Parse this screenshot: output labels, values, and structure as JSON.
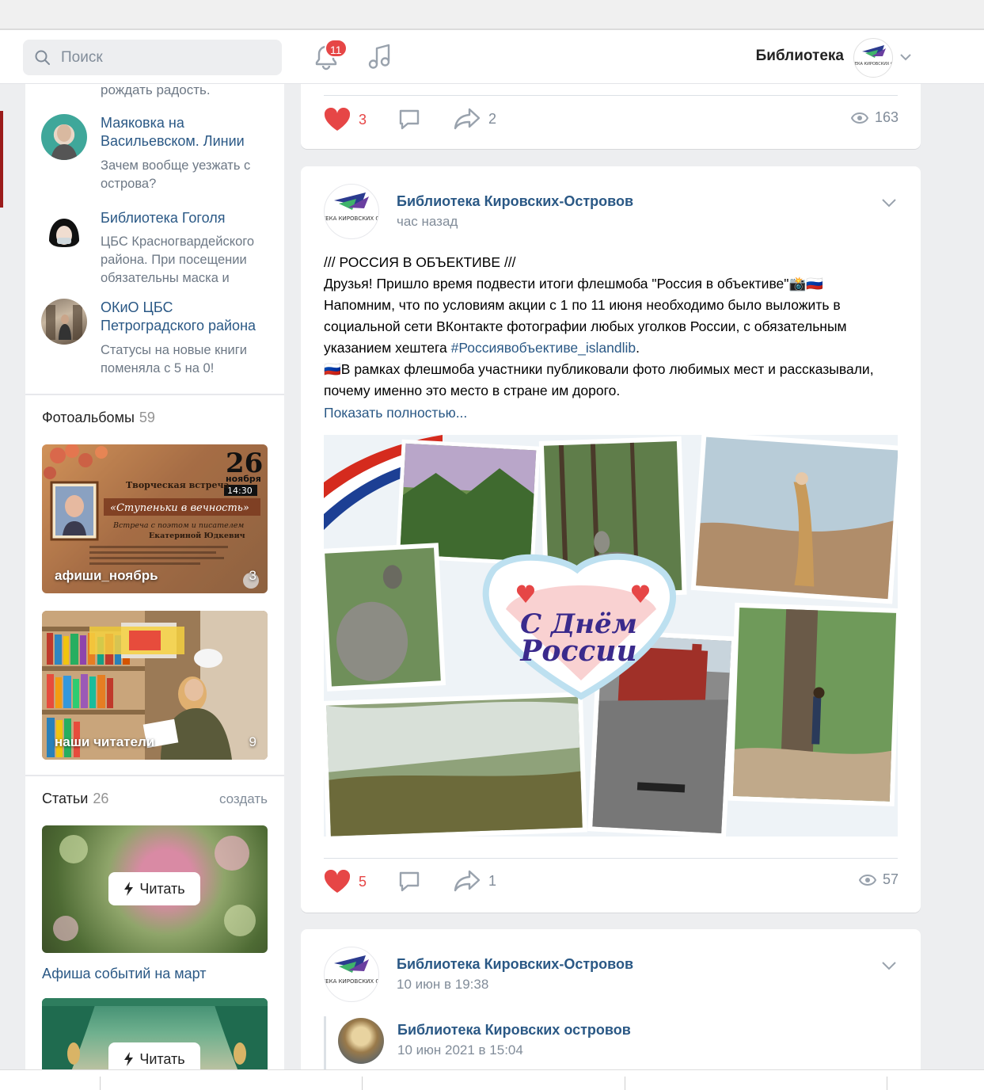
{
  "header": {
    "search_placeholder": "Поиск",
    "notifications_count": "11",
    "profile_name": "Библиотека",
    "profile_logo_text": "БИБЛИОТЕКА КИРОВСКИХ ОСТРОВОВ"
  },
  "sidebar": {
    "cut_text": "рождать радость.",
    "groups": [
      {
        "title": "Маяковка на Васильевском. Линии",
        "desc": "Зачем вообще уезжать с острова?"
      },
      {
        "title": "Библиотека Гоголя",
        "desc": "ЦБС Красногвардейского района. При посещении обязательны маска и"
      },
      {
        "title": "ОКиО ЦБС Петроградского района",
        "desc": "Статусы на новые книги поменяла с 5 на 0!"
      }
    ],
    "albums_section": {
      "title": "Фотоальбомы",
      "count": "59"
    },
    "albums": [
      {
        "label": "афиши_ноябрь",
        "count": "3",
        "poster_date": "26",
        "poster_month": "ноября",
        "poster_time": "14:30",
        "poster_heading": "Творческая встреча",
        "poster_script": "«Ступеньки в вечность»",
        "poster_sub": "Встреча с поэтом и писателем",
        "poster_name": "Екатериной Юдкевич"
      },
      {
        "label": "наши читатели",
        "count": "9"
      }
    ],
    "articles_section": {
      "title": "Статьи",
      "count": "26",
      "create_link": "создать"
    },
    "articles": [
      {
        "title": "Афиша событий на март",
        "read_label": "Читать"
      },
      {
        "title": "",
        "read_label": "Читать"
      }
    ]
  },
  "feed": {
    "post0_actions": {
      "likes": "3",
      "reposts": "2",
      "views": "163"
    },
    "post1": {
      "author": "Библиотека Кировских-Островов",
      "time": "час назад",
      "line1": "/// РОССИЯ В ОБЪЕКТИВЕ ///",
      "line2": "Друзья! Пришло время подвести итоги флешмоба \"Россия в объективе\"📸🇷🇺",
      "line3": "Напомним, что по условиям акции с 1 по 11 июня необходимо было выложить в социальной сети ВКонтакте фотографии любых уголков России, с обязательным указанием хештега ",
      "hashtag": "#Россиявобъективе_islandlib",
      "line3_end": ".",
      "line4": "🇷🇺В рамках флешмоба участники публиковали фото любимых мест и рассказывали, почему именно это место в стране им дорого.",
      "show_more": "Показать полностью...",
      "photo_logo_1": "С Днём",
      "photo_logo_2": "России",
      "likes": "5",
      "reposts": "1",
      "views": "57"
    },
    "post2": {
      "author": "Библиотека Кировских-Островов",
      "time": "10 июн в 19:38",
      "repost_author": "Библиотека Кировских островов",
      "repost_time": "10 июн 2021 в 15:04"
    }
  }
}
